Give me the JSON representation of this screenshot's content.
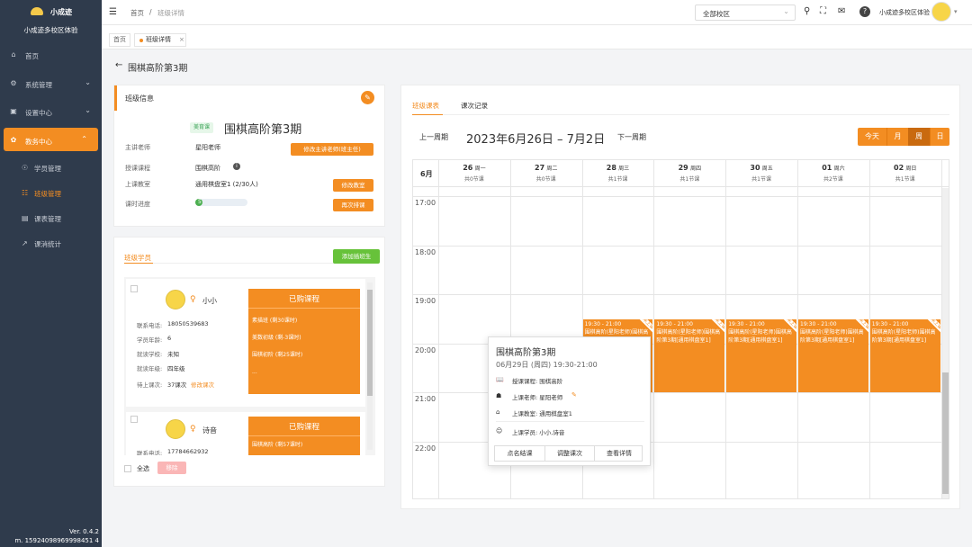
{
  "app": {
    "name": "小成迹",
    "subtitle": "小成迹多校区体验",
    "version": "Ver. 0.4.2",
    "machine": "m. 15924098969998451 4"
  },
  "sidebar": {
    "items": [
      {
        "label": "首页",
        "icon": "home-icon"
      },
      {
        "label": "系统管理",
        "icon": "gear-icon"
      },
      {
        "label": "设置中心",
        "icon": "settings-icon"
      },
      {
        "label": "教务中心",
        "icon": "education-icon"
      }
    ],
    "sub_items": [
      {
        "label": "学员管理",
        "icon": "student-icon"
      },
      {
        "label": "班级管理",
        "icon": "class-icon"
      },
      {
        "label": "课表管理",
        "icon": "schedule-icon"
      },
      {
        "label": "课消统计",
        "icon": "stats-icon"
      }
    ]
  },
  "header": {
    "breadcrumb_home": "首页",
    "breadcrumb_sep": "/",
    "breadcrumb_current": "班级详情",
    "campus": "全部校区",
    "user": "小成迹多校区体验"
  },
  "tabs": {
    "home": "首页",
    "current": "班级详情",
    "close": "×"
  },
  "page": {
    "back": "←",
    "title": "围棋高阶第3期"
  },
  "class_info": {
    "heading": "班级信息",
    "badge": "美育课",
    "name": "围棋高阶第3期",
    "rows": [
      {
        "label": "主讲老师",
        "value": "星阳老师",
        "action": "修改主讲老师(班主任)"
      },
      {
        "label": "授课课程",
        "value": "围棋高阶",
        "action": ""
      },
      {
        "label": "上课教室",
        "value": "通用棋盘室1 (2/30人)",
        "action": "修改教室"
      },
      {
        "label": "课时进度",
        "value": "5",
        "action": "再次排课"
      }
    ],
    "progress": 0.05
  },
  "students": {
    "heading": "班级学员",
    "add": "添加插班生",
    "list": [
      {
        "name": "小小",
        "phone_label": "联系电话:",
        "phone": "18050539683",
        "age_label": "学员年龄:",
        "age": "6",
        "school_label": "就读学校:",
        "school": "未知",
        "grade_label": "就读年级:",
        "grade": "四年级",
        "pending_label": "待上课次:",
        "pending": "37课次",
        "edit": "修改课次",
        "purchased_title": "已购课程",
        "purchased": [
          "素描班 (剩30课时)",
          "美数初级 (剩-3课时)",
          "围棋初阶 (剩25课时)",
          "..."
        ]
      },
      {
        "name": "诗音",
        "phone_label": "联系电话:",
        "phone": "17784662932",
        "purchased_title": "已购课程",
        "purchased": [
          "围棋高阶 (剩57课时)"
        ]
      }
    ],
    "select_all": "全选",
    "remove": "移除"
  },
  "schedule": {
    "tabs": [
      "班级课表",
      "课次记录"
    ],
    "prev": "上一周期",
    "next": "下一周期",
    "range": "2023年6月26日 – 7月2日",
    "views": [
      "今天",
      "月",
      "周",
      "日"
    ],
    "month": "6月",
    "days": [
      {
        "date": "26",
        "wd": "周一",
        "count": "共0节课"
      },
      {
        "date": "27",
        "wd": "周二",
        "count": "共0节课"
      },
      {
        "date": "28",
        "wd": "周三",
        "count": "共1节课"
      },
      {
        "date": "29",
        "wd": "周四",
        "count": "共1节课"
      },
      {
        "date": "30",
        "wd": "周五",
        "count": "共1节课"
      },
      {
        "date": "01",
        "wd": "周六",
        "count": "共2节课"
      },
      {
        "date": "02",
        "wd": "周日",
        "count": "共1节课"
      }
    ],
    "hours": [
      "17:00",
      "18:00",
      "19:00",
      "20:00",
      "21:00",
      "22:00"
    ],
    "event_time": "19:30 - 21:00",
    "event_text": "围棋高阶(星阳老师)围棋高阶第3期[通用棋盘室1]",
    "event_tag": "未上课"
  },
  "popup": {
    "title": "围棋高阶第3期",
    "time": "06月29日 (周四) 19:30-21:00",
    "course": "授课课程: 围棋高阶",
    "teacher": "上课老师: 星阳老师",
    "room": "上课教室: 通用棋盘室1",
    "students": "上课学员: 小小,诗音",
    "actions": [
      "点名结课",
      "调整课次",
      "查看详情"
    ]
  }
}
